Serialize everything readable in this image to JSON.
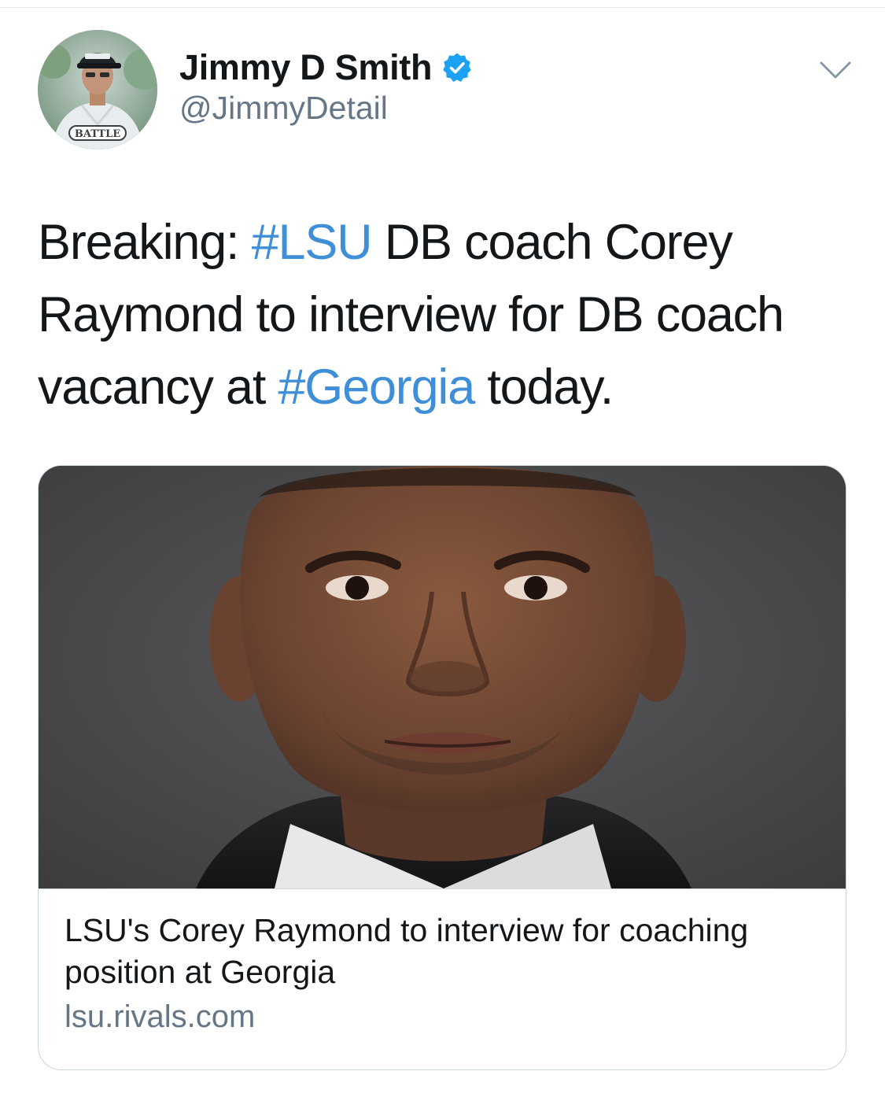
{
  "author": {
    "display_name": "Jimmy D Smith",
    "handle": "@JimmyDetail",
    "verified": true,
    "avatar_caption": "BATTLE"
  },
  "tweet": {
    "segments": [
      {
        "text": "Breaking: ",
        "type": "text"
      },
      {
        "text": "#LSU",
        "type": "hashtag"
      },
      {
        "text": " DB coach Corey Raymond to interview for DB coach vacancy at ",
        "type": "text"
      },
      {
        "text": "#Georgia",
        "type": "hashtag"
      },
      {
        "text": " today.",
        "type": "text"
      }
    ]
  },
  "link_card": {
    "title": "LSU's Corey Raymond to interview for coaching position at Georgia",
    "domain": "lsu.rivals.com"
  },
  "colors": {
    "hashtag": "#3e8fd8",
    "verified_badge": "#1da1f2",
    "text_primary": "#14171a",
    "text_secondary": "#657786"
  },
  "icons": {
    "verified": "verified-badge-icon",
    "menu": "chevron-down-icon"
  }
}
